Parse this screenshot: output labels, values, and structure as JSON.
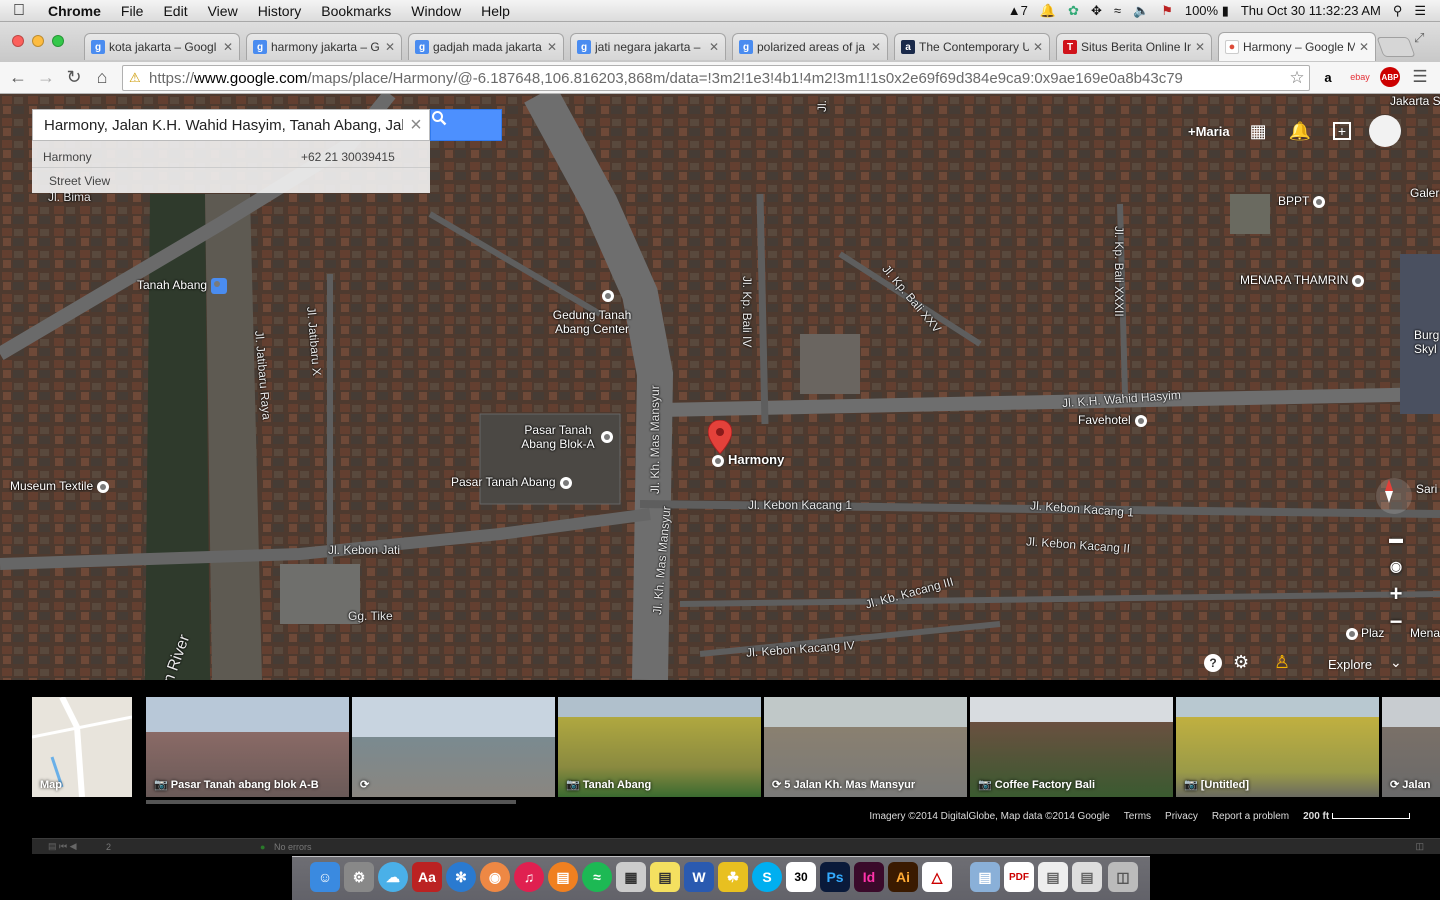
{
  "menubar": {
    "app": "Chrome",
    "items": [
      "File",
      "Edit",
      "View",
      "History",
      "Bookmarks",
      "Window",
      "Help"
    ],
    "status": {
      "adobe": "7",
      "battery": "100%",
      "clock": "Thu Oct 30  11:32:23 AM"
    }
  },
  "tabs": [
    {
      "title": "kota jakarta – Googl",
      "icon": "google-g-icon"
    },
    {
      "title": "harmony jakarta – G",
      "icon": "google-g-icon"
    },
    {
      "title": "gadjah mada jakarta",
      "icon": "google-g-icon"
    },
    {
      "title": "jati negara jakarta –",
      "icon": "google-g-icon"
    },
    {
      "title": "polarized areas of ja",
      "icon": "google-g-icon"
    },
    {
      "title": "The Contemporary U",
      "icon": "amazon-a-icon"
    },
    {
      "title": "Situs Berita Online In",
      "icon": "tempo-t-icon"
    },
    {
      "title": "Harmony – Google M",
      "icon": "google-maps-icon"
    }
  ],
  "address": {
    "scheme": "https://",
    "host": "www.google.com",
    "path": "/maps/place/Harmony/@-6.187648,106.816203,868m/data=!3m2!1e3!4b1!4m2!3m1!1s0x2e69f69d384e9ca9:0x9ae169e0a8b43c79"
  },
  "search": {
    "value": "Harmony, Jalan K.H. Wahid Hasyim, Tanah Abang, Jak",
    "suggestion_name": "Harmony",
    "suggestion_phone": "+62 21 30039415",
    "street_view": "Street View"
  },
  "account": {
    "name": "+Maria"
  },
  "map": {
    "labels": {
      "jakarta": "Jakarta S",
      "jl_bima": "Jl. Bima",
      "ji": "Jl.",
      "tanah_abang": "Tanah Abang",
      "jatibaru_x": "Jl. Jatibaru X",
      "jatibaru_raya": "Jl. Jatibaru Raya",
      "gedung": "Gedung Tanah Abang Center",
      "mas_mansyur_1": "Jl. Kh. Mas Mansyur",
      "mas_mansyur_2": "Jl. Kh. Mas Mansyur",
      "mas_mansyur_3": "Jl. Kh. Mas Mansyur",
      "kp_bali_iv": "Jl. Kp. Bali IV",
      "kp_bali_xxv": "Jl. Kp. Bali XXV",
      "kp_bali_xxxii": "Jl. Kp. Bali XXXII",
      "bppt": "BPPT",
      "galer": "Galer",
      "menara": "MENARA THAMRIN",
      "burg": "Burg",
      "skyl": "Skyl",
      "wahid": "Jl. K.H. Wahid Hasyim",
      "favehotel": "Favehotel",
      "pasar_blok_a": "Pasar Tanah Abang Blok-A",
      "pasar": "Pasar Tanah Abang",
      "harmony": "Harmony",
      "museum": "Museum Textile",
      "kebon_kacang_1a": "Jl. Kebon Kacang 1",
      "kebon_kacang_1b": "Jl. Kebon Kacang 1",
      "kebon_kacang_2": "Jl. Kebon Kacang II",
      "kb_kacang_3": "Jl. Kb. Kacang III",
      "kebon_kacang_4": "Jl. Kebon Kacang IV",
      "kebon_jati": "Jl. Kebon Jati",
      "gg_tike": "Gg. Tike",
      "river": "n River",
      "sari": "Sari",
      "plaz": "Plaz",
      "mena": "Mena"
    },
    "explore": "Explore"
  },
  "thumbnails": [
    {
      "label": "Map",
      "type": "map"
    },
    {
      "label": "Pasar Tanah abang blok A-B",
      "type": "photo"
    },
    {
      "label": "",
      "type": "streetview"
    },
    {
      "label": "Tanah Abang",
      "type": "photo"
    },
    {
      "label": "5 Jalan Kh. Mas Mansyur",
      "type": "streetview"
    },
    {
      "label": "Coffee Factory Bali",
      "type": "photo"
    },
    {
      "label": "[Untitled]",
      "type": "photo"
    },
    {
      "label": "Jalan",
      "type": "streetview"
    }
  ],
  "footer": {
    "imagery": "Imagery ©2014 DigitalGlobe, Map data ©2014 Google",
    "terms": "Terms",
    "privacy": "Privacy",
    "report": "Report a problem",
    "scale": "200 ft"
  },
  "devbar": {
    "count": "2",
    "errors": "No errors"
  },
  "dock": {
    "calendar_day": "30"
  }
}
